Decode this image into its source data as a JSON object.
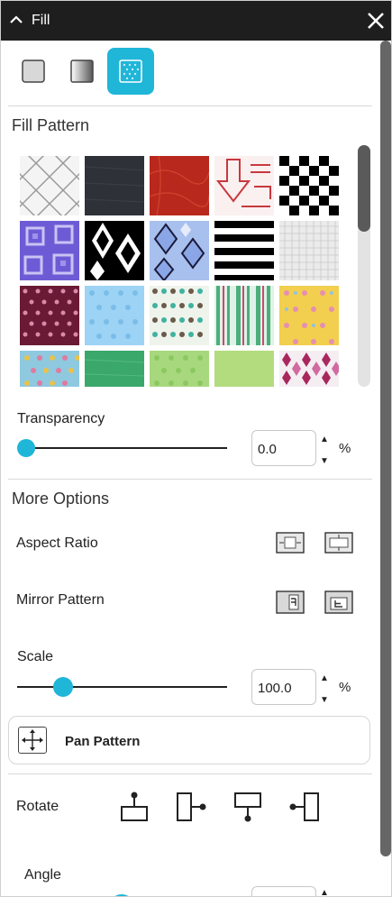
{
  "title": "Fill",
  "fill_tabs": [
    "no-fill",
    "gradient",
    "pattern"
  ],
  "selected_tab": "pattern",
  "fill_pattern": {
    "heading": "Fill Pattern",
    "rows": [
      [
        "lattice",
        "dark-fabric",
        "red-texture",
        "red-arrows",
        "checkerboard"
      ],
      [
        "purple-squares",
        "black-diamonds",
        "blue-diamonds",
        "black-stripes",
        "gray-mesh"
      ],
      [
        "maroon-dots",
        "light-blue-dots",
        "argyle-dots",
        "green-stripes",
        "yellow-dots"
      ],
      [
        "multicolor-dots",
        "green-texture",
        "light-green-dots",
        "light-green",
        "magenta-harlequin"
      ]
    ]
  },
  "transparency": {
    "label": "Transparency",
    "value": "0.0",
    "unit": "%",
    "level": 0
  },
  "more_options": {
    "heading": "More Options",
    "aspect_ratio_label": "Aspect Ratio",
    "mirror_label": "Mirror Pattern",
    "scale_label": "Scale",
    "scale_value": "100.0",
    "scale_unit": "%",
    "scale_level": 0.22,
    "pan_label": "Pan Pattern",
    "rotate_label": "Rotate",
    "angle_label": "Angle"
  },
  "colors": {
    "accent": "#1fb6d8",
    "titlebar": "#1e1e1e"
  }
}
